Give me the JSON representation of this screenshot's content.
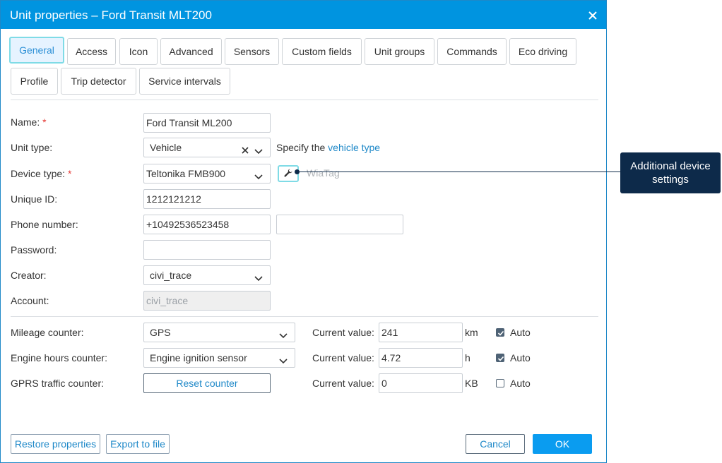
{
  "dialog": {
    "title": "Unit properties – Ford Transit MLT200"
  },
  "tabs": [
    {
      "label": "General",
      "active": true
    },
    {
      "label": "Access"
    },
    {
      "label": "Icon"
    },
    {
      "label": "Advanced"
    },
    {
      "label": "Sensors"
    },
    {
      "label": "Custom fields"
    },
    {
      "label": "Unit groups"
    },
    {
      "label": "Commands"
    },
    {
      "label": "Eco driving"
    },
    {
      "label": "Profile"
    },
    {
      "label": "Trip detector"
    },
    {
      "label": "Service intervals"
    }
  ],
  "form": {
    "name": {
      "label": "Name:",
      "required_mark": "*",
      "value": "Ford Transit ML200"
    },
    "unit_type": {
      "label": "Unit type:",
      "value": "Vehicle",
      "hint_prefix": "Specify the",
      "hint_link": "vehicle type"
    },
    "device_type": {
      "label": "Device type:",
      "required_mark": "*",
      "value": "Teltonika FMB900",
      "ghost_text": "WiaTag"
    },
    "unique_id": {
      "label": "Unique ID:",
      "value": "1212121212"
    },
    "phone": {
      "label": "Phone number:",
      "value": "+10492536523458",
      "value2": ""
    },
    "password": {
      "label": "Password:",
      "value": ""
    },
    "creator": {
      "label": "Creator:",
      "value": "civi_trace"
    },
    "account": {
      "label": "Account:",
      "value": "civi_trace"
    }
  },
  "counters": {
    "mileage": {
      "label": "Mileage counter:",
      "value": "GPS",
      "current_label": "Current value:",
      "current": "241",
      "unit": "km",
      "auto_label": "Auto",
      "auto": true
    },
    "engine": {
      "label": "Engine hours counter:",
      "value": "Engine ignition sensor",
      "current_label": "Current value:",
      "current": "4.72",
      "unit": "h",
      "auto_label": "Auto",
      "auto": true
    },
    "gprs": {
      "label": "GPRS traffic counter:",
      "button": "Reset counter",
      "current_label": "Current value:",
      "current": "0",
      "unit": "KB",
      "auto_label": "Auto",
      "auto": false
    }
  },
  "footer": {
    "restore": "Restore properties",
    "export": "Export to file",
    "cancel": "Cancel",
    "ok": "OK"
  },
  "callout": {
    "text": "Additional device settings"
  },
  "colors": {
    "titlebar": "#0094e0",
    "accent": "#1e88c8",
    "callout_bg": "#0d2a4a",
    "ok_button": "#0a9cf0",
    "required": "#e53935"
  }
}
